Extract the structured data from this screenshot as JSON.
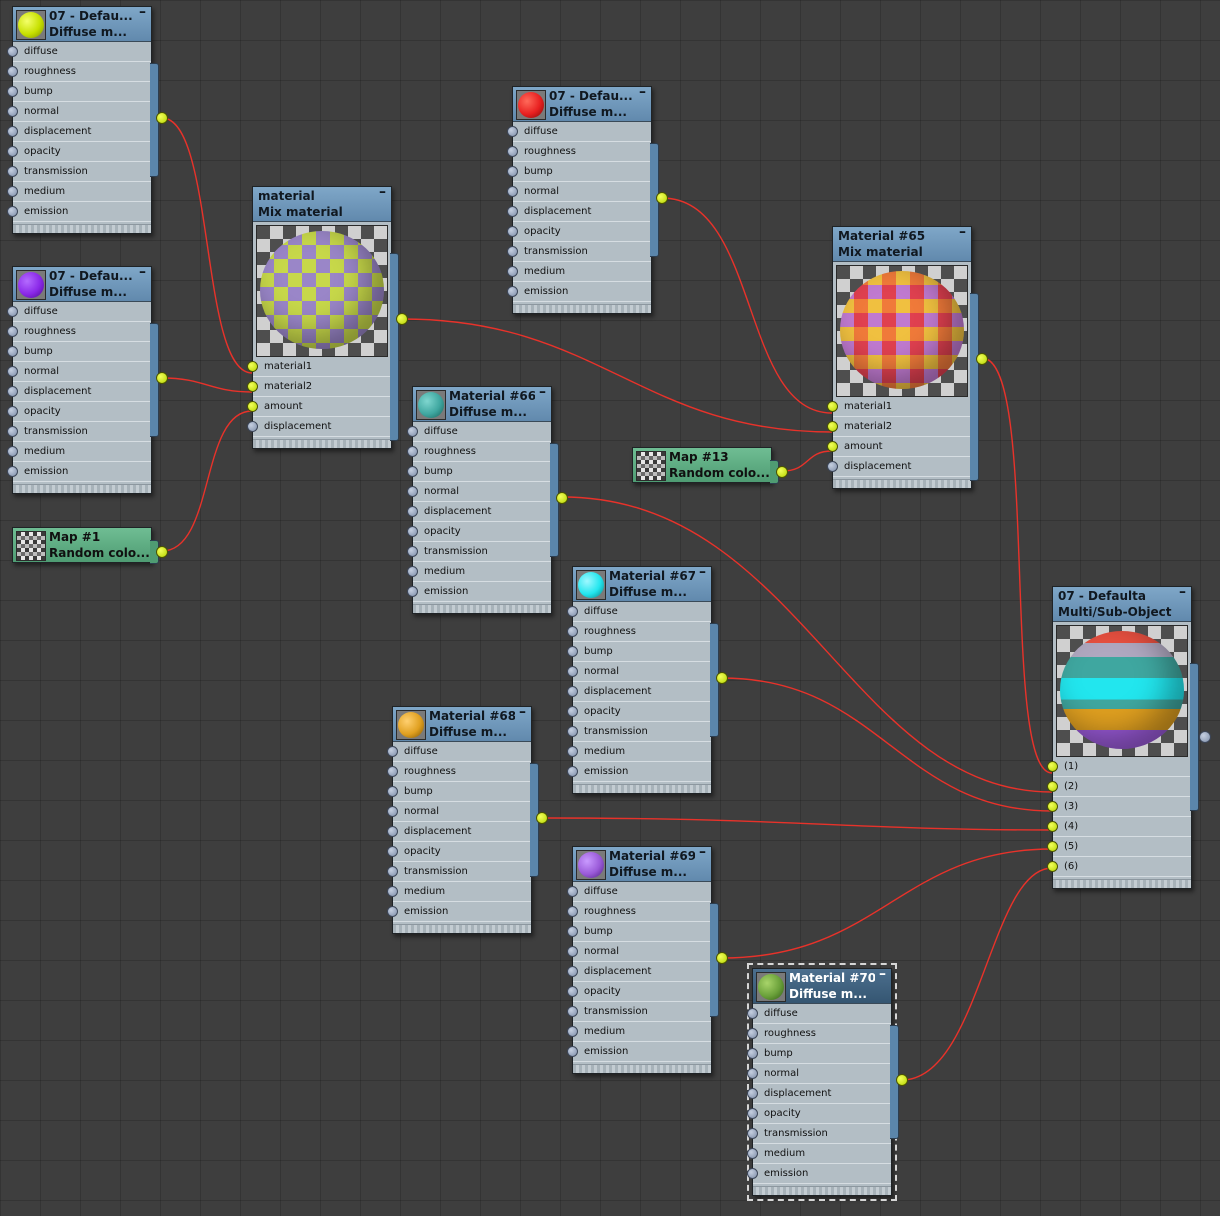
{
  "slots_diffuse": [
    "diffuse",
    "roughness",
    "bump",
    "normal",
    "displacement",
    "opacity",
    "transmission",
    "medium",
    "emission"
  ],
  "slots_mix": [
    "material1",
    "material2",
    "amount",
    "displacement"
  ],
  "slots_multi": [
    "(1)",
    "(2)",
    "(3)",
    "(4)",
    "(5)",
    "(6)"
  ],
  "colors": {
    "wire": "#e8322a",
    "socket_active": "#d4ee00",
    "header": "#6f98bc",
    "map_header": "#5aa97f"
  },
  "nodes": {
    "n1": {
      "title": "07 - Defau...",
      "subtitle": "Diffuse m...",
      "color": "#d6f000",
      "icon": "yellow-sphere-icon"
    },
    "n2": {
      "title": "07 - Defau...",
      "subtitle": "Diffuse m...",
      "color": "#8a28e8",
      "icon": "purple-sphere-icon"
    },
    "n3": {
      "title": "07 - Defau...",
      "subtitle": "Diffuse m...",
      "color": "#e82020",
      "icon": "red-sphere-icon"
    },
    "mix1": {
      "title": "material",
      "subtitle": "Mix material"
    },
    "m65": {
      "title": "Material #65",
      "subtitle": "Mix material"
    },
    "m66": {
      "title": "Material #66",
      "subtitle": "Diffuse m...",
      "color": "#3fa7a0",
      "icon": "teal-sphere-icon"
    },
    "m67": {
      "title": "Material #67",
      "subtitle": "Diffuse m...",
      "color": "#22e6ee",
      "icon": "cyan-sphere-icon"
    },
    "m68": {
      "title": "Material #68",
      "subtitle": "Diffuse m...",
      "color": "#e0a020",
      "icon": "orange-sphere-icon"
    },
    "m69": {
      "title": "Material #69",
      "subtitle": "Diffuse m...",
      "color": "#9a5ad8",
      "icon": "violet-sphere-icon"
    },
    "m70": {
      "title": "Material #70",
      "subtitle": "Diffuse m...",
      "color": "#6aa03a",
      "icon": "green-sphere-icon"
    },
    "multi": {
      "title": "07 - Defaulta",
      "subtitle": "Multi/Sub-Object"
    }
  },
  "maps": {
    "map1": {
      "title": "Map #1",
      "subtitle": "Random  colo..."
    },
    "map13": {
      "title": "Map #13",
      "subtitle": "Random  colo..."
    }
  }
}
